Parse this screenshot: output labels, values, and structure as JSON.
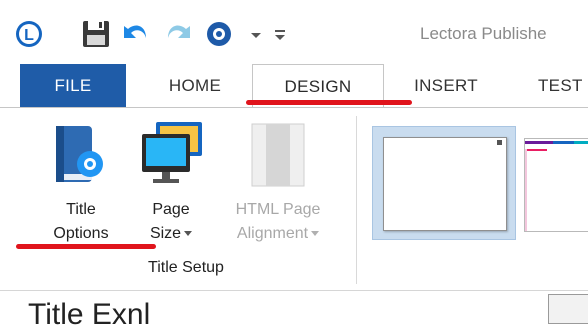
{
  "app": {
    "title": "Lectora Publishe"
  },
  "tabs": {
    "file": "FILE",
    "home": "HOME",
    "design": "DESIGN",
    "insert": "INSERT",
    "test": "TEST"
  },
  "ribbon": {
    "title_options": {
      "line1": "Title",
      "line2": "Options"
    },
    "page_size": {
      "line1": "Page",
      "line2": "Size"
    },
    "html_alignment": {
      "line1": "HTML Page",
      "line2": "Alignment"
    },
    "group_label": "Title Setup"
  },
  "bottom": {
    "partial_text": "Title Exnl"
  },
  "colors": {
    "file_tab": "#1f5ca8",
    "annotation": "#e0141c",
    "theme_selected": "#c9dcef"
  },
  "icons": {
    "app_logo": "lectora-logo-icon",
    "save": "save-icon",
    "undo": "undo-icon",
    "redo": "redo-icon",
    "settings": "gear-icon"
  }
}
